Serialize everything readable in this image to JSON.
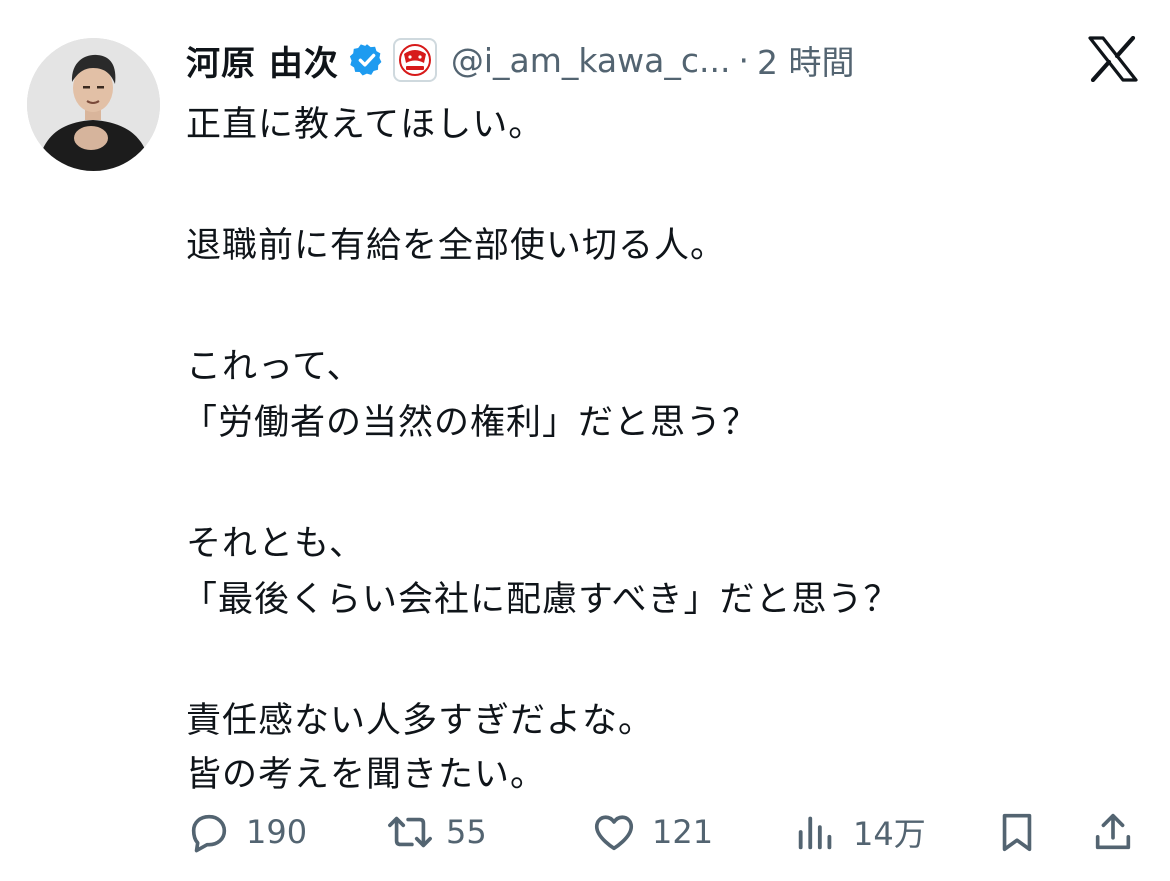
{
  "user": {
    "display_name": "河原 由次",
    "handle": "@i_am_kawa_c...",
    "separator": "·",
    "time": "2 時間",
    "verified_icon": "verified-badge-icon",
    "affiliate_icon": "channel-logo-icon"
  },
  "post": {
    "lines": [
      "正直に教えてほしい。",
      "退職前に有給を全部使い切る人。",
      "これって、",
      "「労働者の当然の権利」だと思う？",
      "それとも、",
      "「最後くらい会社に配慮すべき」だと思う？",
      "責任感ない人多すぎだよな。",
      "皆の考えを聞きたい。"
    ]
  },
  "actions": {
    "replies": "190",
    "reposts": "55",
    "likes": "121",
    "views": "14万"
  },
  "colors": {
    "text": "#0f1419",
    "muted": "#536471",
    "verified": "#1d9bf0"
  }
}
